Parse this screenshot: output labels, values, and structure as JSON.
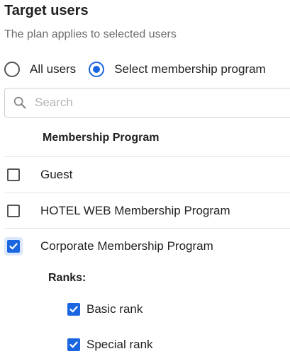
{
  "header": {
    "title": "Target users",
    "subtitle": "The plan applies to selected users"
  },
  "target_mode": {
    "options": [
      {
        "label": "All users",
        "checked": false
      },
      {
        "label": "Select membership program",
        "checked": true
      }
    ]
  },
  "search": {
    "placeholder": "Search",
    "value": ""
  },
  "table": {
    "column_header": "Membership Program",
    "rows": [
      {
        "label": "Guest",
        "checked": false
      },
      {
        "label": "HOTEL WEB Membership Program",
        "checked": false
      },
      {
        "label": "Corporate Membership Program",
        "checked": true
      }
    ]
  },
  "ranks": {
    "label": "Ranks:",
    "items": [
      {
        "label": "Basic rank",
        "checked": true
      },
      {
        "label": "Special rank",
        "checked": true
      }
    ]
  },
  "colors": {
    "accent": "#1a66e0",
    "focus_bg": "#dce7fb",
    "divider": "#e4e4e4"
  }
}
